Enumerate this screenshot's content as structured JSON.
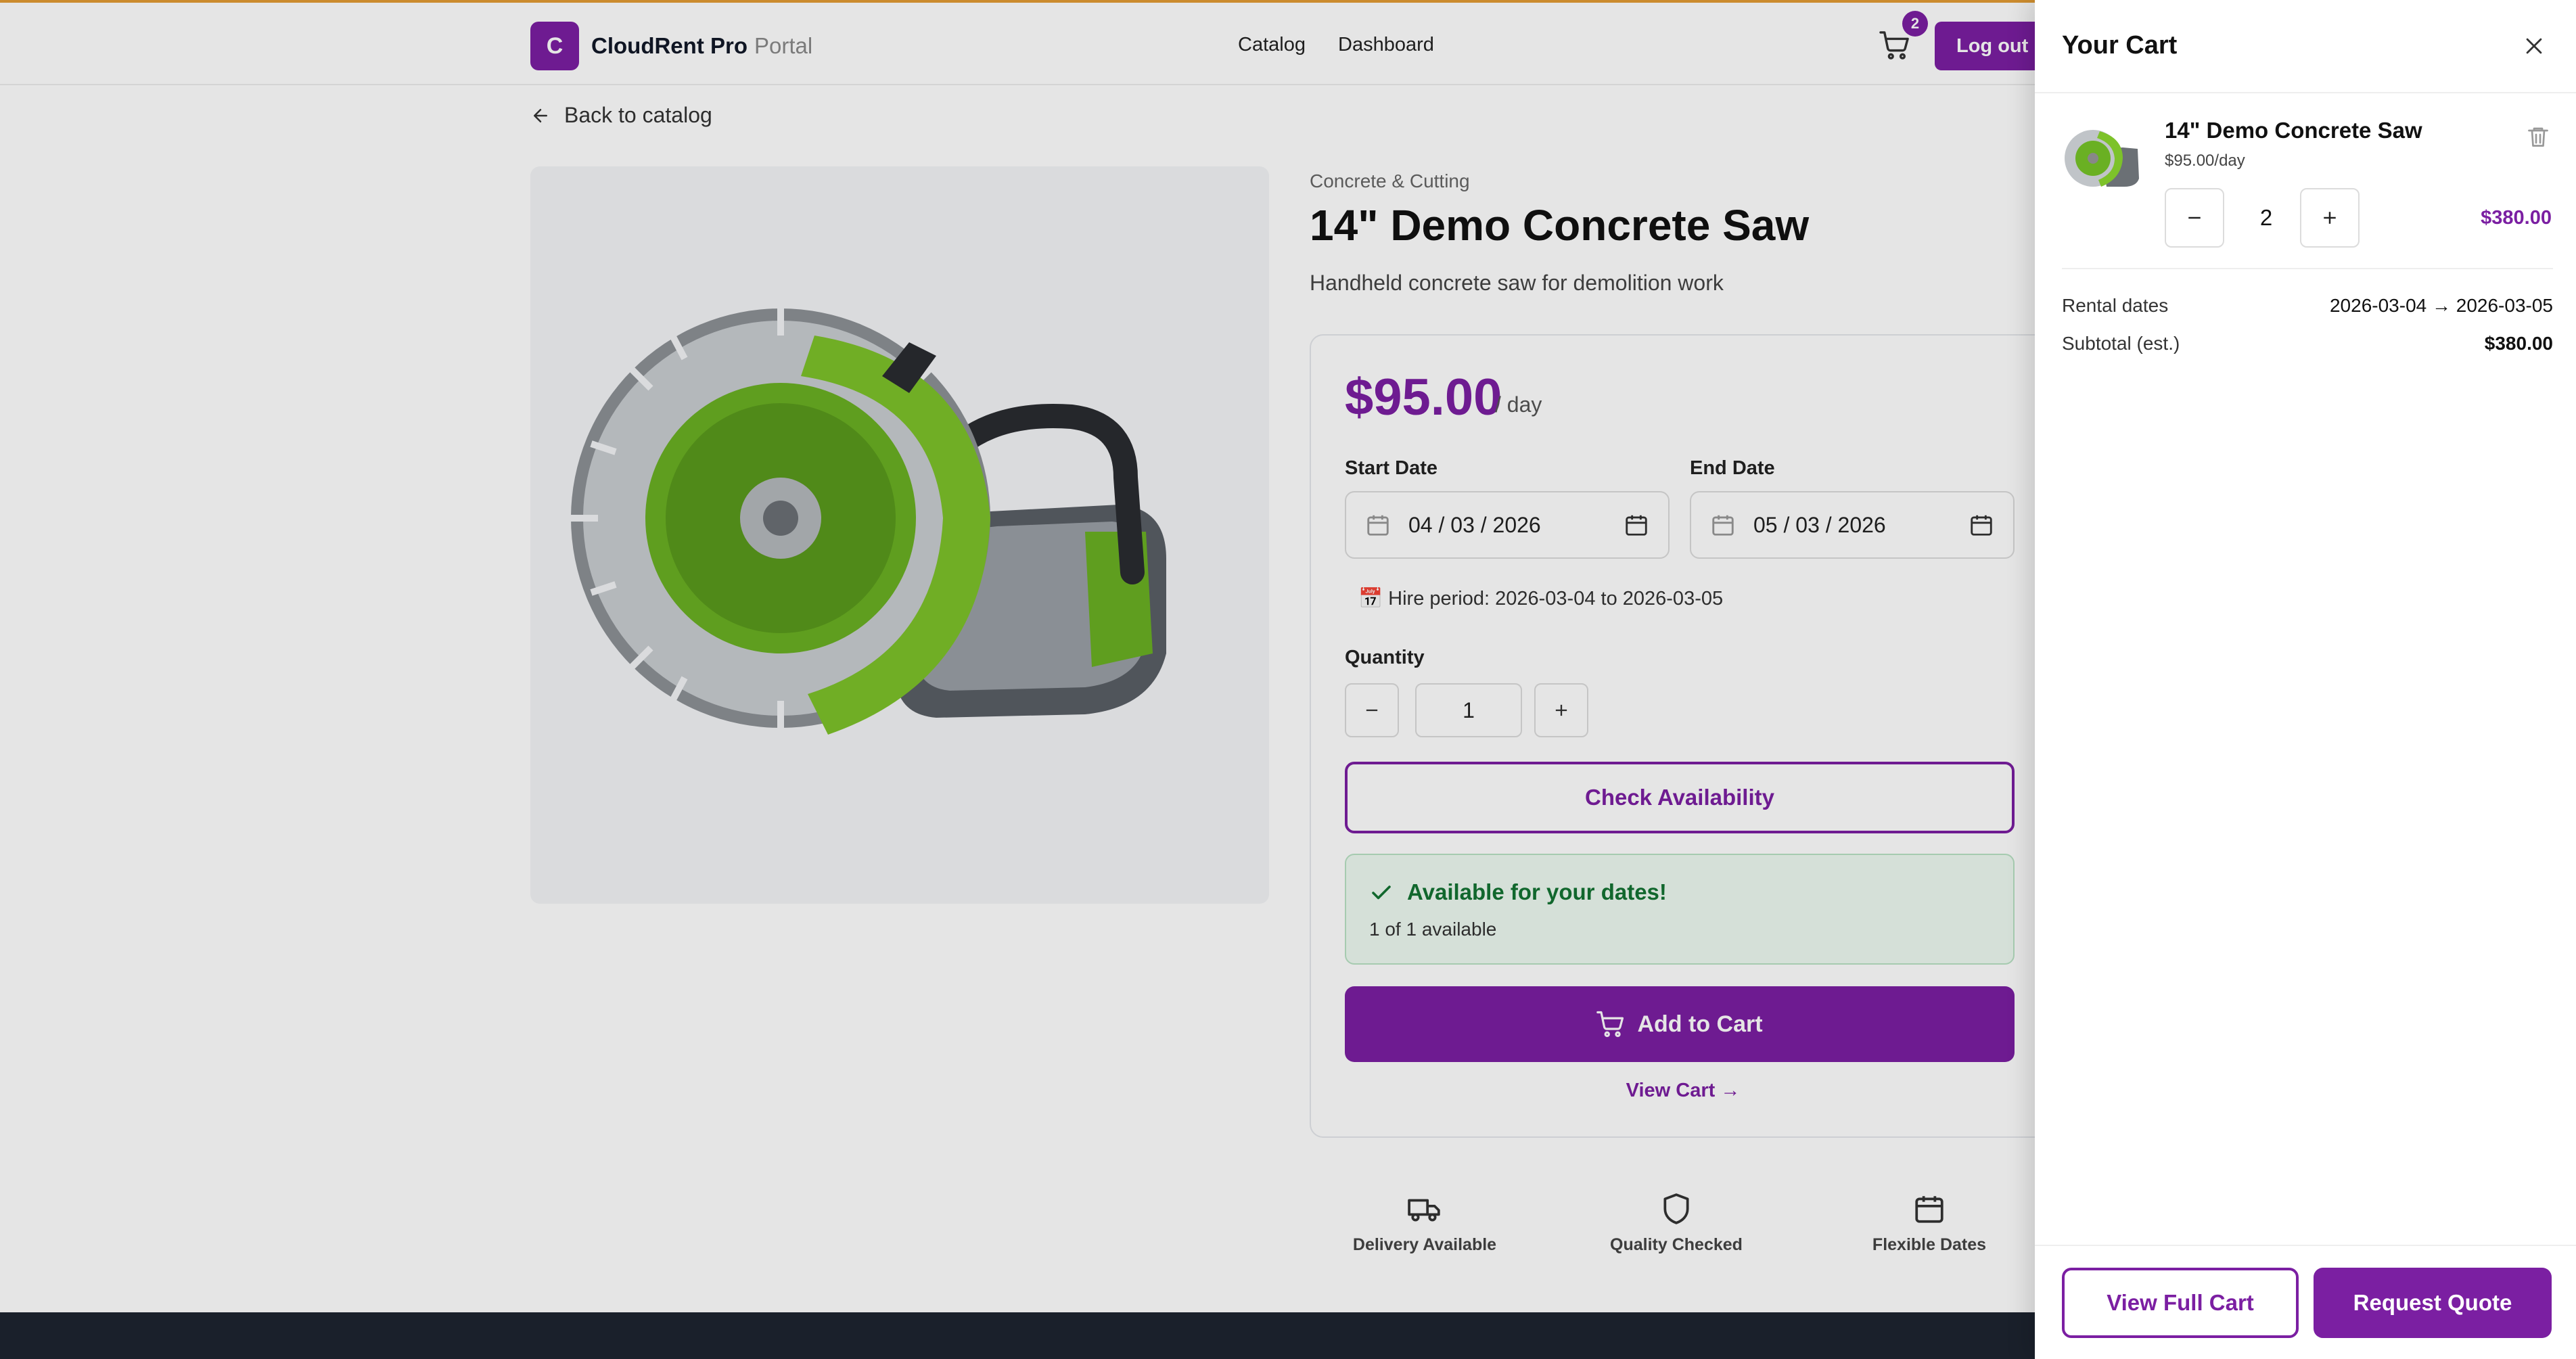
{
  "header": {
    "brand_initial": "C",
    "brand_name": "CloudRent Pro",
    "brand_suffix": "Portal",
    "nav": [
      "Catalog",
      "Dashboard"
    ],
    "cart_count": "2",
    "logout_label": "Log out"
  },
  "product": {
    "back_label": "Back to catalog",
    "category": "Concrete & Cutting",
    "title": "14\" Demo Concrete Saw",
    "description": "Handheld concrete saw for demolition work",
    "price": "$95.00",
    "price_unit": "/ day",
    "start_label": "Start Date",
    "start_value": "04 / 03 / 2026",
    "end_label": "End Date",
    "end_value": "05 / 03 / 2026",
    "hire_period": "📅 Hire period: 2026-03-04 to 2026-03-05",
    "quantity_label": "Quantity",
    "quantity_value": "1",
    "check_label": "Check Availability",
    "available_title": "Available for your dates!",
    "available_sub": "1 of 1 available",
    "add_to_cart": "Add to Cart",
    "view_cart": "View Cart →",
    "features": [
      "Delivery Available",
      "Quality Checked",
      "Flexible Dates"
    ]
  },
  "cart": {
    "title": "Your Cart",
    "item_name": "14\" Demo Concrete Saw",
    "item_rate": "$95.00/day",
    "item_qty": "2",
    "item_total": "$380.00",
    "rental_dates_label": "Rental dates",
    "rental_dates_value": "2026-03-04 → 2026-03-05",
    "subtotal_label": "Subtotal (est.)",
    "subtotal_value": "$380.00",
    "view_full_cart": "View Full Cart",
    "request_quote": "Request Quote"
  },
  "colors": {
    "accent": "#7b1fa2",
    "success": "#137333",
    "success_bg": "#eefaf1"
  },
  "icons": [
    "arrow-left-icon",
    "cart-icon",
    "calendar-icon",
    "check-icon",
    "truck-icon",
    "shield-icon",
    "close-icon",
    "trash-icon",
    "minus-icon",
    "plus-icon"
  ]
}
